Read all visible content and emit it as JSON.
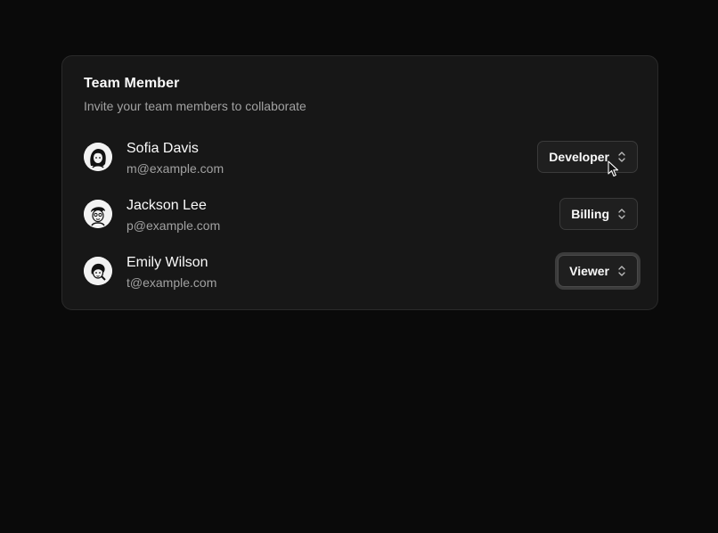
{
  "card": {
    "title": "Team Member",
    "description": "Invite your team members to collaborate"
  },
  "members": [
    {
      "name": "Sofia Davis",
      "email": "m@example.com",
      "role": "Developer",
      "avatar_icon": "avatar-illustration-icon"
    },
    {
      "name": "Jackson Lee",
      "email": "p@example.com",
      "role": "Billing",
      "avatar_icon": "avatar-illustration-icon"
    },
    {
      "name": "Emily Wilson",
      "email": "t@example.com",
      "role": "Viewer",
      "avatar_icon": "avatar-illustration-icon"
    }
  ],
  "icons": {
    "select_indicator": "chevrons-up-down-icon",
    "pointer": "mouse-cursor-icon"
  },
  "colors": {
    "page_background": "#0a0a0a",
    "card_background": "#171717",
    "muted_text": "#a1a1a1"
  }
}
